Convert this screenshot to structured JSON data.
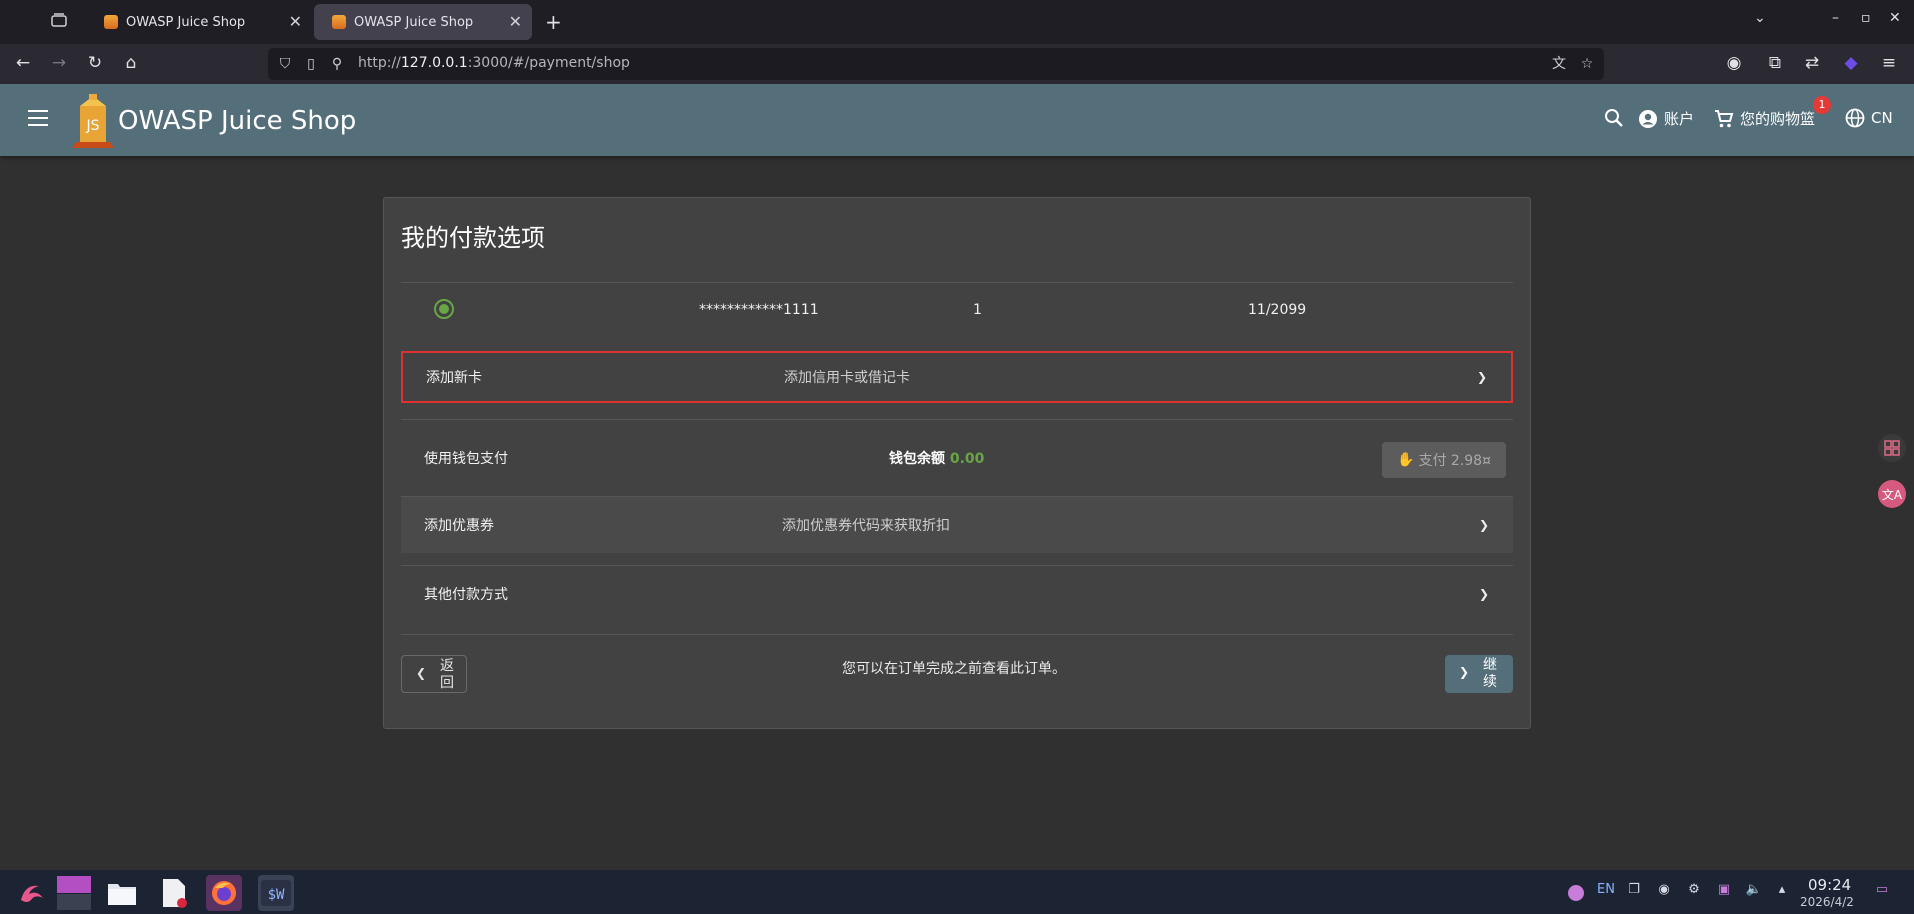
{
  "browser": {
    "tabs": [
      {
        "title": "OWASP Juice Shop",
        "active": false
      },
      {
        "title": "OWASP Juice Shop",
        "active": true
      }
    ],
    "url_prefix": "http://",
    "url_host": "127.0.0.1",
    "url_rest": ":3000/#/payment/shop"
  },
  "header": {
    "app_title": "OWASP Juice Shop",
    "account_label": "账户",
    "basket_label": "您的购物篮",
    "basket_count": "1",
    "language_label": "CN"
  },
  "payment": {
    "title": "我的付款选项",
    "saved_card": {
      "number": "************1111",
      "name": "1",
      "expiry": "11/2099"
    },
    "add_card": {
      "title": "添加新卡",
      "description": "添加信用卡或借记卡"
    },
    "wallet": {
      "title": "使用钱包支付",
      "balance_label": "钱包余额",
      "balance_value": "0.00",
      "pay_label": "支付 2.98¤"
    },
    "coupon": {
      "title": "添加优惠券",
      "description": "添加优惠券代码来获取折扣"
    },
    "other": {
      "title": "其他付款方式"
    },
    "back_label": "返回",
    "review_note": "您可以在订单完成之前查看此订单。",
    "continue_label": "继续"
  },
  "taskbar": {
    "tray_lang": "EN",
    "time": "09:24",
    "date": "2026/4/2"
  },
  "colors": {
    "toolbar": "#546e7a",
    "card": "#424242",
    "accent_green": "#69a544",
    "highlight_red": "#e03131"
  }
}
